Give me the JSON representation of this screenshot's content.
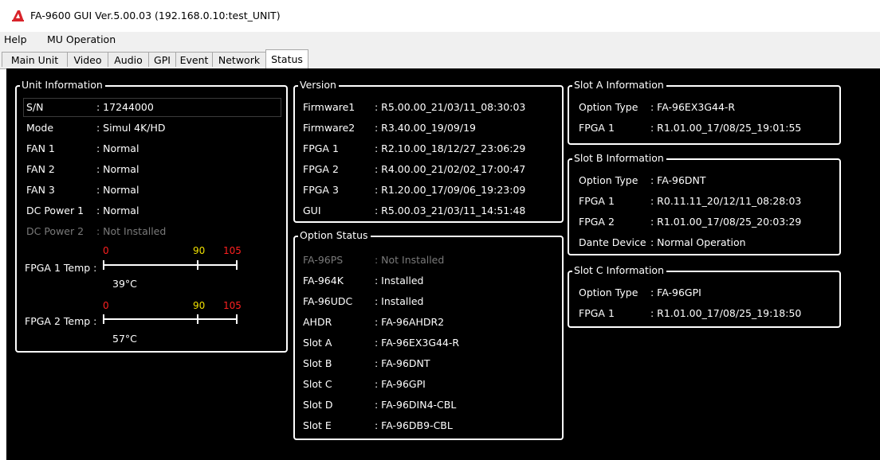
{
  "window": {
    "title": "FA-9600 GUI Ver.5.00.03 (192.168.0.10:test_UNIT)",
    "icon": "app-logo-icon",
    "accent": "#d8232a"
  },
  "menu": {
    "items": [
      "Help",
      "MU Operation"
    ]
  },
  "tabs": [
    "Main Unit",
    "Video",
    "Audio",
    "GPI",
    "Event",
    "Network",
    "Status"
  ],
  "active_tab": "Status",
  "unit_info": {
    "title": "Unit Information",
    "rows": [
      {
        "label": "S/N",
        "value": ": 17244000"
      },
      {
        "label": "Mode",
        "value": ": Simul 4K/HD"
      },
      {
        "label": "FAN 1",
        "value": ": Normal"
      },
      {
        "label": "FAN 2",
        "value": ": Normal"
      },
      {
        "label": "FAN 3",
        "value": ": Normal"
      },
      {
        "label": "DC Power 1",
        "value": ": Normal"
      },
      {
        "label": "DC Power 2",
        "value": ": Not Installed"
      }
    ],
    "temps": [
      {
        "label": "FPGA 1 Temp :",
        "value": "39°C",
        "celsius": 39
      },
      {
        "label": "FPGA 2 Temp :",
        "value": "57°C",
        "celsius": 57
      }
    ],
    "scale": {
      "min": "0",
      "warn": "90",
      "max": "105",
      "min_color": "#ff2020",
      "warn_color": "#f0e000",
      "max_color": "#ff2020"
    }
  },
  "version": {
    "title": "Version",
    "rows": [
      {
        "label": "Firmware1",
        "value": ": R5.00.00_21/03/11_08:30:03"
      },
      {
        "label": "Firmware2",
        "value": ": R3.40.00_19/09/19"
      },
      {
        "label": "FPGA 1",
        "value": ": R2.10.00_18/12/27_23:06:29"
      },
      {
        "label": "FPGA 2",
        "value": ": R4.00.00_21/02/02_17:00:47"
      },
      {
        "label": "FPGA 3",
        "value": ": R1.20.00_17/09/06_19:23:09"
      },
      {
        "label": "GUI",
        "value": ": R5.00.03_21/03/11_14:51:48"
      }
    ]
  },
  "option_status": {
    "title": "Option Status",
    "rows": [
      {
        "label": "FA-96PS",
        "value": ": Not Installed"
      },
      {
        "label": "FA-964K",
        "value": ": Installed"
      },
      {
        "label": "FA-96UDC",
        "value": ": Installed"
      },
      {
        "label": "AHDR",
        "value": ": FA-96AHDR2"
      },
      {
        "label": "Slot A",
        "value": ": FA-96EX3G44-R"
      },
      {
        "label": "Slot B",
        "value": ": FA-96DNT"
      },
      {
        "label": "Slot C",
        "value": ": FA-96GPI"
      },
      {
        "label": "Slot D",
        "value": ": FA-96DIN4-CBL"
      },
      {
        "label": "Slot E",
        "value": ": FA-96DB9-CBL"
      }
    ]
  },
  "slot_a": {
    "title": "Slot A Information",
    "rows": [
      {
        "label": "Option Type",
        "value": ": FA-96EX3G44-R"
      },
      {
        "label": "FPGA 1",
        "value": ": R1.01.00_17/08/25_19:01:55"
      }
    ]
  },
  "slot_b": {
    "title": "Slot B Information",
    "rows": [
      {
        "label": "Option Type",
        "value": ": FA-96DNT"
      },
      {
        "label": "FPGA 1",
        "value": ": R0.11.11_20/12/11_08:28:03"
      },
      {
        "label": "FPGA 2",
        "value": ": R1.01.00_17/08/25_20:03:29"
      },
      {
        "label": "Dante Device",
        "value": ": Normal Operation"
      }
    ]
  },
  "slot_c": {
    "title": "Slot C Information",
    "rows": [
      {
        "label": "Option Type",
        "value": ": FA-96GPI"
      },
      {
        "label": "FPGA 1",
        "value": ": R1.01.00_17/08/25_19:18:50"
      }
    ]
  }
}
